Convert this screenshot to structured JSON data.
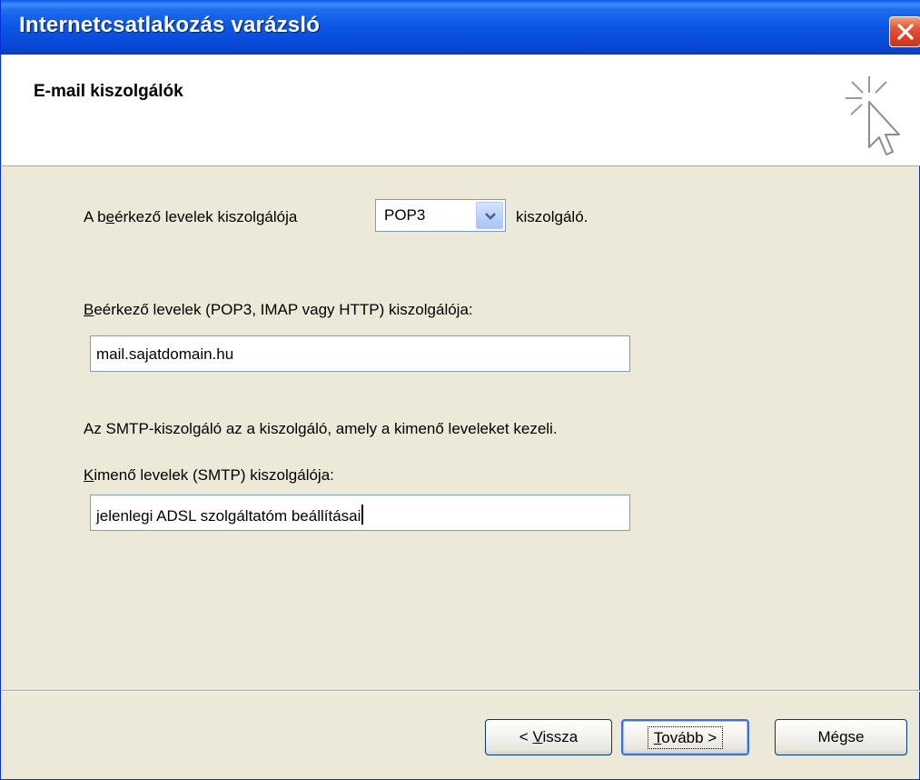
{
  "window": {
    "title": "Internetcsatlakozás varázsló"
  },
  "header": {
    "title": "E-mail kiszolgálók",
    "icon": "wizard-cursor-icon"
  },
  "incoming_type": {
    "prefix_a": "A b",
    "prefix_accel": "e",
    "prefix_b": "érkező levelek kiszolgálója",
    "selected": "POP3",
    "suffix": "kiszolgáló."
  },
  "incoming_server": {
    "label_accel": "B",
    "label_rest": "eérkező levelek (POP3, IMAP vagy HTTP) kiszolgálója:",
    "value": "mail.sajatdomain.hu"
  },
  "smtp_info": "Az SMTP-kiszolgáló az a kiszolgáló, amely a kimenő leveleket kezeli.",
  "outgoing_server": {
    "label_accel": "K",
    "label_rest": "imenő levelek (SMTP) kiszolgálója:",
    "value": "jelenlegi ADSL szolgáltatóm beállításai"
  },
  "buttons": {
    "back_prefix": "< ",
    "back_accel": "V",
    "back_rest": "issza",
    "next_accel": "T",
    "next_rest": "ovább >",
    "cancel": "Mégse"
  },
  "colors": {
    "titlebar": "#0a56e3",
    "dialog_bg": "#ece9d8",
    "close": "#d8401f"
  }
}
